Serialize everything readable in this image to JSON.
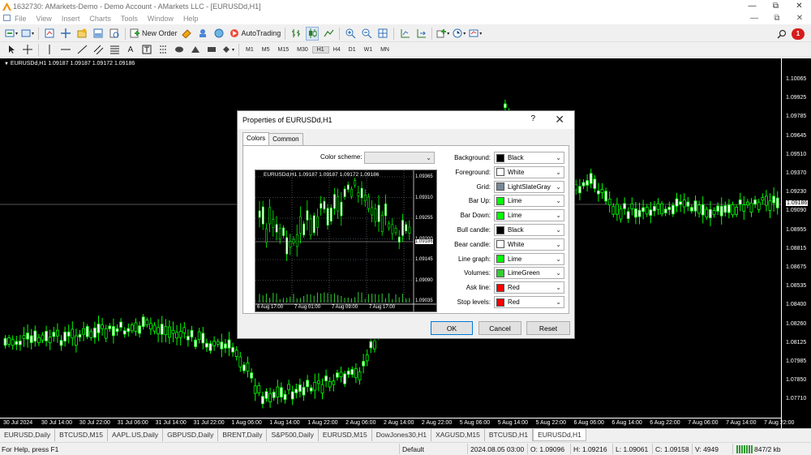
{
  "window": {
    "title": "1632730: AMarkets-Demo - Demo Account - AMarkets LLC - [EURUSDd,H1]"
  },
  "menu": [
    "File",
    "View",
    "Insert",
    "Charts",
    "Tools",
    "Window",
    "Help"
  ],
  "toolbar": {
    "new_order": "New Order",
    "autotrading": "AutoTrading",
    "alert_count": "1"
  },
  "timeframes": [
    "M1",
    "M5",
    "M15",
    "M30",
    "H1",
    "H4",
    "D1",
    "W1",
    "MN"
  ],
  "active_timeframe": "H1",
  "chart": {
    "header": "EURUSDd,H1  1.09187 1.09187 1.09172 1.09186",
    "price_labels": [
      "1.10065",
      "1.09925",
      "1.09785",
      "1.09645",
      "1.09510",
      "1.09370",
      "1.09230",
      "1.09090",
      "1.08955",
      "1.08815",
      "1.08675",
      "1.08535",
      "1.08400",
      "1.08260",
      "1.08125",
      "1.07985",
      "1.07850",
      "1.07710"
    ],
    "current_price": "1.09186",
    "time_labels": [
      "30 Jul 2024",
      "30 Jul 14:00",
      "30 Jul 22:00",
      "31 Jul 06:00",
      "31 Jul 14:00",
      "31 Jul 22:00",
      "1 Aug 06:00",
      "1 Aug 14:00",
      "1 Aug 22:00",
      "2 Aug 06:00",
      "2 Aug 14:00",
      "2 Aug 22:00",
      "5 Aug 06:00",
      "5 Aug 14:00",
      "5 Aug 22:00",
      "6 Aug 06:00",
      "6 Aug 14:00",
      "6 Aug 22:00",
      "7 Aug 06:00",
      "7 Aug 14:00",
      "7 Aug 22:00"
    ],
    "colors": {
      "background": "#000000",
      "candle": "#00ff00",
      "grid": "#778899"
    }
  },
  "dialog": {
    "title": "Properties of EURUSDd,H1",
    "help": "?",
    "tabs": [
      "Colors",
      "Common"
    ],
    "color_scheme_label": "Color scheme:",
    "color_scheme_value": "",
    "preview": {
      "header": "EURUSDd,H1  1.09187 1.09187 1.09172 1.09186",
      "price_labels": [
        "1.09365",
        "1.09310",
        "1.09255",
        "1.09200",
        "1.09145",
        "1.09090",
        "1.09035"
      ],
      "current_price": "1.09186",
      "time_labels": [
        "6 Aug 17:00",
        "7 Aug 01:00",
        "7 Aug 09:00",
        "7 Aug 17:00"
      ]
    },
    "properties": [
      {
        "label": "Background:",
        "value": "Black",
        "color": "#000000"
      },
      {
        "label": "Foreground:",
        "value": "White",
        "color": "#ffffff"
      },
      {
        "label": "Grid:",
        "value": "LightSlateGray",
        "color": "#778899"
      },
      {
        "label": "Bar Up:",
        "value": "Lime",
        "color": "#00ff00"
      },
      {
        "label": "Bar Down:",
        "value": "Lime",
        "color": "#00ff00"
      },
      {
        "label": "Bull candle:",
        "value": "Black",
        "color": "#000000"
      },
      {
        "label": "Bear candle:",
        "value": "White",
        "color": "#ffffff"
      },
      {
        "label": "Line graph:",
        "value": "Lime",
        "color": "#00ff00"
      },
      {
        "label": "Volumes:",
        "value": "LimeGreen",
        "color": "#32cd32"
      },
      {
        "label": "Ask line:",
        "value": "Red",
        "color": "#ff0000"
      },
      {
        "label": "Stop levels:",
        "value": "Red",
        "color": "#ff0000"
      }
    ],
    "buttons": {
      "ok": "OK",
      "cancel": "Cancel",
      "reset": "Reset"
    }
  },
  "tabs": [
    "EURUSD,Daily",
    "BTCUSD,M15",
    "AAPL.US,Daily",
    "GBPUSD,Daily",
    "BRENT,Daily",
    "S&P500,Daily",
    "EURUSD,M15",
    "DowJones30,H1",
    "XAGUSD,M15",
    "BTCUSD,H1",
    "EURUSDd,H1"
  ],
  "active_tab": "EURUSDd,H1",
  "status": {
    "help": "For Help, press F1",
    "profile": "Default",
    "datetime": "2024.08.05 03:00",
    "open": "O: 1.09096",
    "high": "H: 1.09216",
    "low": "L: 1.09061",
    "close": "C: 1.09158",
    "volume": "V: 4949",
    "traffic": "847/2 kb"
  }
}
